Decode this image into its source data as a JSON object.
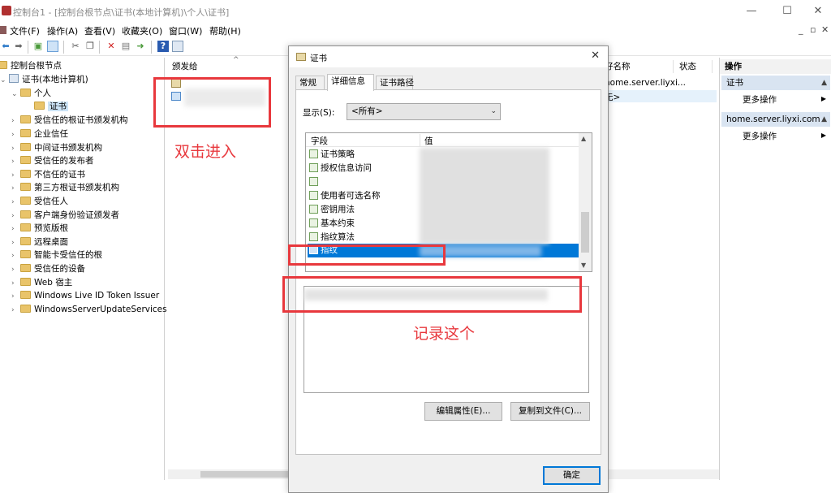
{
  "window": {
    "title": "控制台1 - [控制台根节点\\证书(本地计算机)\\个人\\证书]",
    "minimize": "—",
    "maximize": "☐",
    "close": "✕"
  },
  "menu": {
    "items": [
      "文件(F)",
      "操作(A)",
      "查看(V)",
      "收藏夹(O)",
      "窗口(W)",
      "帮助(H)"
    ],
    "mdi_minimize": "_",
    "mdi_restore": "▫",
    "mdi_close": "✕"
  },
  "tree": {
    "root": "控制台根节点",
    "computer": "证书(本地计算机)",
    "personal": "个人",
    "certs": "证书",
    "stores": [
      "受信任的根证书颁发机构",
      "企业信任",
      "中间证书颁发机构",
      "受信任的发布者",
      "不信任的证书",
      "第三方根证书颁发机构",
      "受信任人",
      "客户端身份验证颁发者",
      "预览版根",
      "远程桌面",
      "智能卡受信任的根",
      "受信任的设备",
      "Web 宿主",
      "Windows Live ID Token Issuer",
      "WindowsServerUpdateServices"
    ]
  },
  "list": {
    "col_issued_to": "颁发给",
    "col_friendly_name": "好名称",
    "col_status": "状态",
    "row1_name": "home.server.liyxi...",
    "row2_name": "无>"
  },
  "actions": {
    "header": "操作",
    "section1": "证书",
    "more1": "更多操作",
    "section2": "home.server.liyxi.com",
    "more2": "更多操作"
  },
  "dialog": {
    "title": "证书",
    "close": "✕",
    "tabs": [
      "常规",
      "详细信息",
      "证书路径"
    ],
    "show_label": "显示(S):",
    "show_value": "<所有>",
    "col_field": "字段",
    "col_value": "值",
    "fields": [
      "证书策略",
      "授权信息访问",
      "",
      "使用者可选名称",
      "密钥用法",
      "基本约束",
      "指纹算法",
      "指纹"
    ],
    "edit_button": "编辑属性(E)...",
    "copy_button": "复制到文件(C)...",
    "ok_button": "确定"
  },
  "annotations": {
    "double_click": "双击进入",
    "record_this": "记录这个",
    "color": "#e8383d"
  }
}
